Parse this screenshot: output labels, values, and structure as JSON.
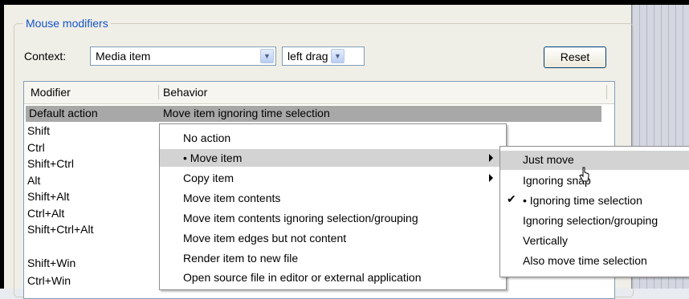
{
  "group_title": "Mouse modifiers",
  "context": {
    "label": "Context:",
    "selected": "Media item",
    "action_selected": "left drag",
    "arrow": "▼"
  },
  "reset_label": "Reset",
  "table": {
    "col_modifier": "Modifier",
    "col_behavior": "Behavior",
    "selected_modifier": "Default action",
    "selected_behavior": "Move item ignoring time selection",
    "modifiers": [
      "Shift",
      "Ctrl",
      "Shift+Ctrl",
      "Alt",
      "Shift+Alt",
      "Ctrl+Alt",
      "Shift+Ctrl+Alt",
      "Shift+Win",
      "Ctrl+Win"
    ]
  },
  "menu": {
    "items": [
      "No action",
      "• Move item",
      "Copy item",
      "Move item contents",
      "Move item contents ignoring selection/grouping",
      "Move item edges but not content",
      "Render item to new file",
      "Open source file in editor or external application"
    ]
  },
  "submenu": {
    "items": [
      "Just move",
      "Ignoring snap",
      "• Ignoring time selection",
      "Ignoring selection/grouping",
      "Vertically",
      "Also move time selection"
    ],
    "check_mark": "✔"
  }
}
